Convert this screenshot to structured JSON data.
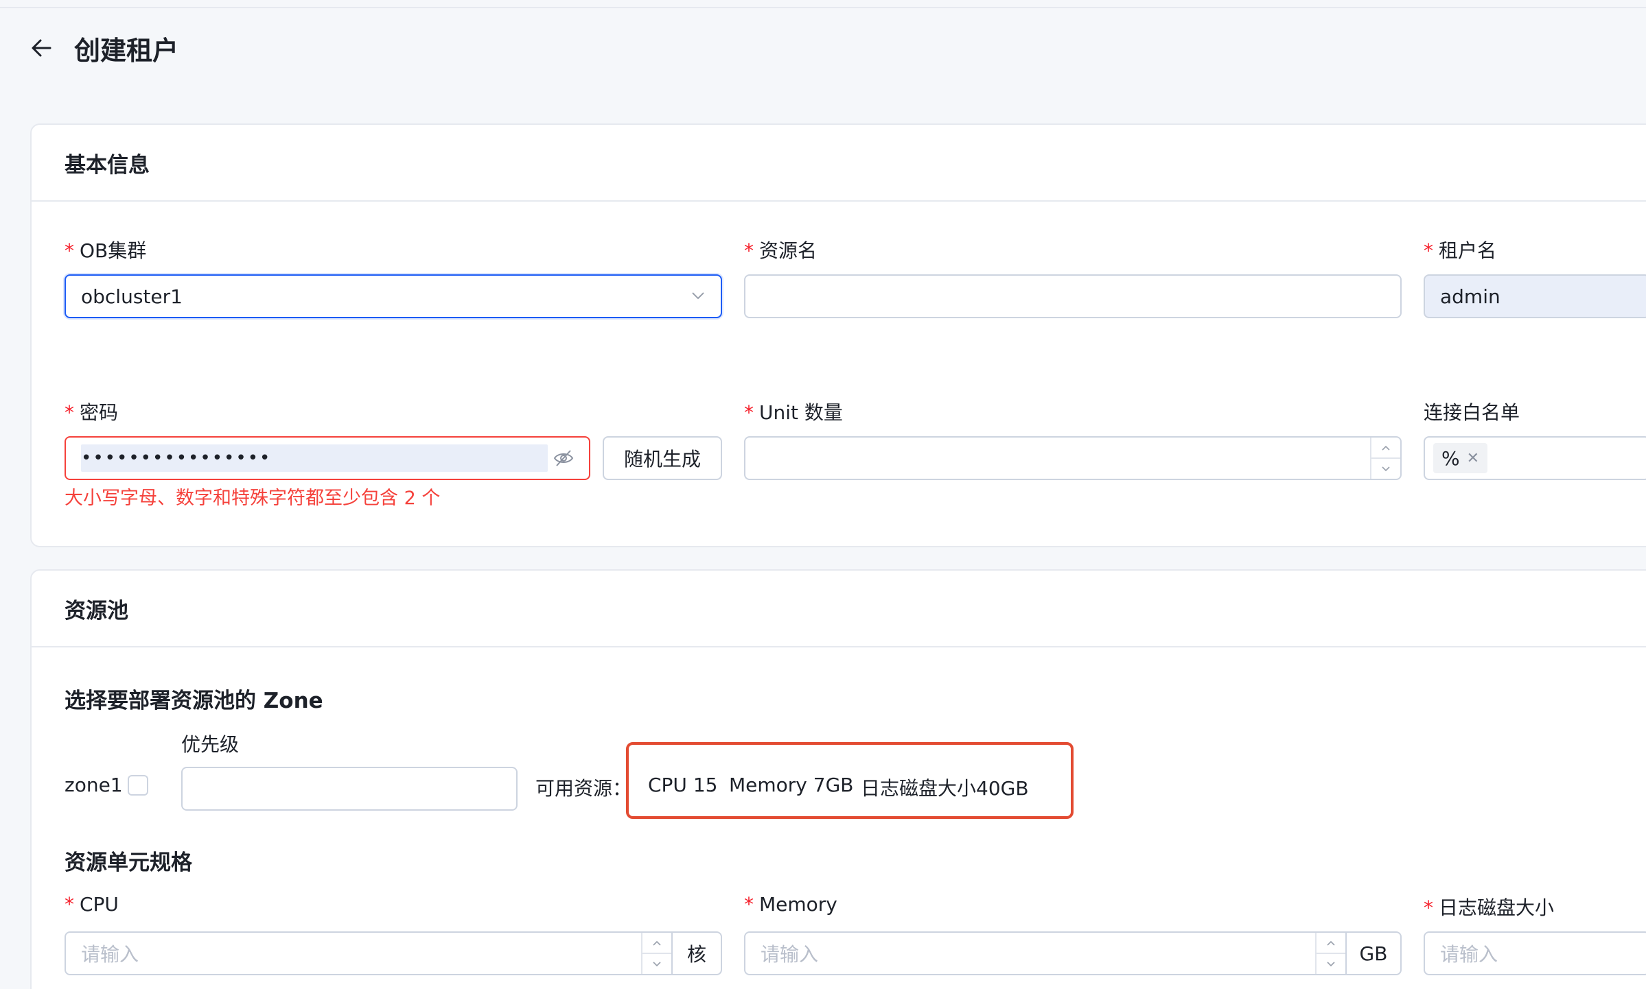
{
  "page": {
    "title": "创建租户"
  },
  "basic": {
    "title": "基本信息",
    "cluster": {
      "label": "OB集群",
      "value": "obcluster1"
    },
    "resource_name": {
      "label": "资源名",
      "value": ""
    },
    "tenant_name": {
      "label": "租户名",
      "value": "admin"
    },
    "password": {
      "label": "密码",
      "value": "••••••••••••••••",
      "random_button": "随机生成",
      "error": "大小写字母、数字和特殊字符都至少包含 2 个"
    },
    "unit_count": {
      "label": "Unit 数量",
      "value": ""
    },
    "whitelist": {
      "label": "连接白名单",
      "tag": "%"
    }
  },
  "pool": {
    "title": "资源池",
    "zone_section_title": "选择要部署资源池的 Zone",
    "priority_label": "优先级",
    "zone_name": "zone1",
    "available_label": "可用资源：",
    "available": {
      "cpu": "CPU 15",
      "memory": "Memory 7GB",
      "log_disk": "日志磁盘大小40GB"
    },
    "spec_title": "资源单元规格",
    "cpu": {
      "label": "CPU",
      "placeholder": "请输入",
      "unit": "核"
    },
    "memory": {
      "label": "Memory",
      "placeholder": "请输入",
      "unit": "GB"
    },
    "log_disk": {
      "label": "日志磁盘大小",
      "placeholder": "请输入"
    }
  },
  "colors": {
    "primary": "#1d5cf5",
    "error": "#f5413b",
    "required": "#f5222d",
    "highlight_box": "#e34b32"
  }
}
